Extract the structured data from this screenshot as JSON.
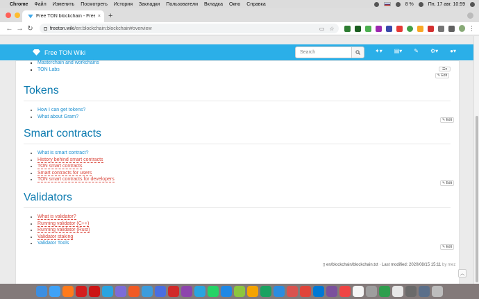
{
  "menubar": {
    "app_name": "Chrome",
    "items": [
      "Файл",
      "Изменить",
      "Посмотреть",
      "История",
      "Закладки",
      "Пользователи",
      "Вкладка",
      "Окно",
      "Справка"
    ],
    "battery": "8 %",
    "datetime": "Пн, 17 авг.  10:59"
  },
  "browser": {
    "tab_title": "Free TON blockchain - Free TO",
    "url_host": "freeton.wiki",
    "url_path": "/en:blockchain:blockchain#overview",
    "new_tab": "+",
    "close_tab": "×"
  },
  "wiki": {
    "brand": "Free TON Wiki",
    "search_placeholder": "Search",
    "top_items": [
      {
        "label": "Masterchain and workchains",
        "color": "blue"
      },
      {
        "label": "TON Labs",
        "color": "blue"
      }
    ],
    "sections": [
      {
        "title": "Tokens",
        "items": [
          {
            "label": "How I can get tokens?",
            "color": "blue"
          },
          {
            "label": "What about Gram?",
            "color": "blue"
          }
        ]
      },
      {
        "title": "Smart contracts",
        "items": [
          {
            "label": "What is smart contract?",
            "color": "blue"
          },
          {
            "label": "History behind smart contracts",
            "color": "red"
          },
          {
            "label": "TON smart contracts",
            "color": "red"
          },
          {
            "label": "Smart contracts for users",
            "color": "red"
          },
          {
            "label": "TON smart contracts for developers",
            "color": "red"
          }
        ]
      },
      {
        "title": "Validators",
        "items": [
          {
            "label": "What is validator?",
            "color": "red"
          },
          {
            "label": "Running validator (C++)",
            "color": "red"
          },
          {
            "label": "Running validator (Rust)",
            "color": "red"
          },
          {
            "label": "Validator staking",
            "color": "red"
          },
          {
            "label": "Validator Tools",
            "color": "blue"
          }
        ]
      }
    ],
    "edit_label": "✎ Edit",
    "footer_path": "en/blockchain/blockchain.txt",
    "footer_modified": "· Last modified: 2020/08/15 15:11",
    "footer_by": "by mez",
    "colors": {
      "nav": "#2bafe8",
      "heading": "#0d7bb0",
      "link": "#1a8fd0",
      "missing_link": "#d9453a"
    }
  }
}
